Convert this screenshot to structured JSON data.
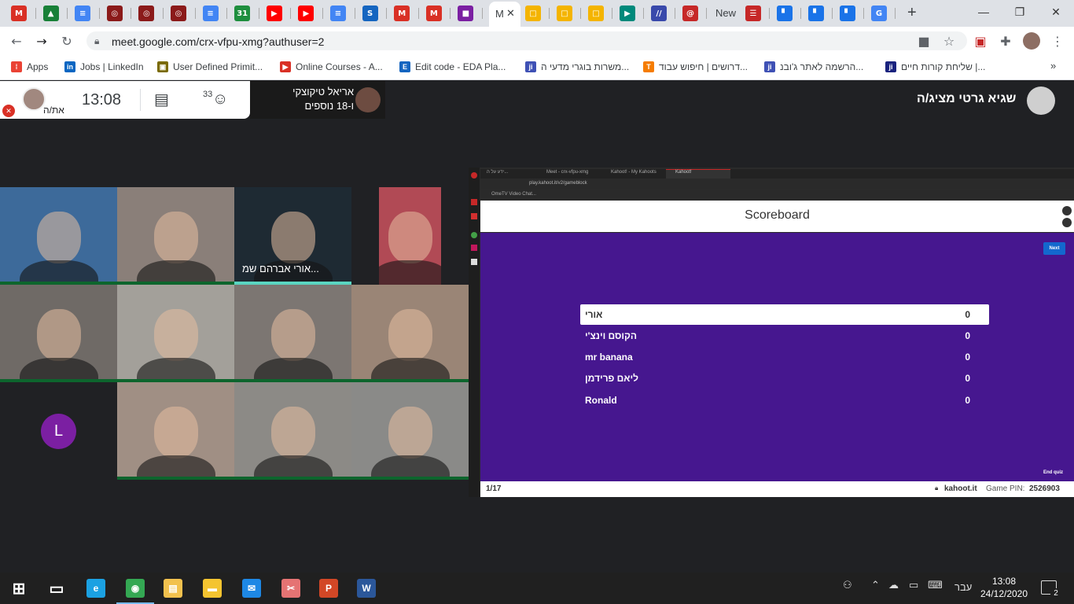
{
  "browser": {
    "tabs": [
      {
        "favicon": "gmail-icon",
        "color": "#d93025",
        "letter": "M"
      },
      {
        "favicon": "drive-icon",
        "color": "#188038",
        "letter": "▲"
      },
      {
        "favicon": "docs-icon",
        "color": "#4285f4",
        "letter": "≡"
      },
      {
        "favicon": "generic-icon",
        "color": "#8b1a1a",
        "letter": "◎"
      },
      {
        "favicon": "generic-icon",
        "color": "#8b1a1a",
        "letter": "◎"
      },
      {
        "favicon": "generic-icon",
        "color": "#8b1a1a",
        "letter": "◎"
      },
      {
        "favicon": "docs-icon",
        "color": "#4285f4",
        "letter": "≡"
      },
      {
        "favicon": "calendar-icon",
        "color": "#1e8e3e",
        "letter": "31"
      },
      {
        "favicon": "youtube-icon",
        "color": "#ff0000",
        "letter": "▶"
      },
      {
        "favicon": "youtube-icon",
        "color": "#ff0000",
        "letter": "▶"
      },
      {
        "favicon": "docs-icon",
        "color": "#4285f4",
        "letter": "≡"
      },
      {
        "favicon": "s-icon",
        "color": "#1565c0",
        "letter": "S"
      },
      {
        "favicon": "gmail-icon",
        "color": "#d93025",
        "letter": "M"
      },
      {
        "favicon": "gmail-icon",
        "color": "#d93025",
        "letter": "M"
      },
      {
        "favicon": "classroom-icon",
        "color": "#7b1fa2",
        "letter": "■"
      }
    ],
    "active_tab_label": "M",
    "tabs_right": [
      {
        "favicon": "slides-icon",
        "color": "#f4b400",
        "letter": "□"
      },
      {
        "favicon": "slides-icon",
        "color": "#f4b400",
        "letter": "□"
      },
      {
        "favicon": "slides-icon",
        "color": "#f4b400",
        "letter": "□"
      },
      {
        "favicon": "meet-icon",
        "color": "#00897b",
        "letter": "▶"
      },
      {
        "favicon": "edu-icon",
        "color": "#3949ab",
        "letter": "//"
      },
      {
        "favicon": "swirl-icon",
        "color": "#c62828",
        "letter": "@"
      }
    ],
    "new_tab_label": "New",
    "tabs_right2": [
      {
        "favicon": "form-icon",
        "color": "#c62828",
        "letter": "☰"
      },
      {
        "favicon": "comment-icon",
        "color": "#1a73e8",
        "letter": "▘"
      },
      {
        "favicon": "comment-icon",
        "color": "#1a73e8",
        "letter": "▘"
      },
      {
        "favicon": "comment-icon",
        "color": "#1a73e8",
        "letter": "▘"
      },
      {
        "favicon": "google-icon",
        "color": "#4285f4",
        "letter": "G"
      }
    ],
    "url": "meet.google.com/crx-vfpu-xmg?authuser=2",
    "bookmarks": [
      {
        "label": "Apps",
        "color": "#ea4335",
        "letter": "⁞"
      },
      {
        "label": "Jobs | LinkedIn",
        "color": "#0a66c2",
        "letter": "in"
      },
      {
        "label": "User Defined Primit...",
        "color": "#7a6a00",
        "letter": "▣"
      },
      {
        "label": "Online Courses - A...",
        "color": "#d93025",
        "letter": "▶"
      },
      {
        "label": "Edit code - EDA Pla...",
        "color": "#1565c0",
        "letter": "E"
      },
      {
        "label": "משרות בוגרי מדעי ה...",
        "color": "#3f51b5",
        "letter": "ji"
      },
      {
        "label": "דרושים | חיפוש עבוד...",
        "color": "#f57c00",
        "letter": "T"
      },
      {
        "label": "הרשמה לאתר ג'ובנ...",
        "color": "#3f51b5",
        "letter": "ji"
      },
      {
        "label": "שליחת קורות חיים |...",
        "color": "#1a237e",
        "letter": "ji"
      }
    ]
  },
  "meet": {
    "self_label": "את/ה",
    "time": "13:08",
    "participants_count": "33",
    "presenter_name": "אריאל טיקוצקי",
    "presenter_others": "ו-18 נוספים",
    "presenting_label": "שגיא גרטי מציג/ה",
    "tile_name": "אורי אברהם שמ...",
    "tile_letter": "L",
    "tiles": [
      {
        "bg": "#3d6a9a"
      },
      {
        "bg": "#8a7f79"
      },
      {
        "bg": "#1e2a33"
      },
      {
        "bg": "#b14a55"
      },
      {
        "bg": "#6f6a66"
      },
      {
        "bg": "#a3a09a"
      },
      {
        "bg": "#7c7672"
      },
      {
        "bg": "#9a8576"
      },
      {
        "bg": "#202124"
      },
      {
        "bg": "#a08f84"
      },
      {
        "bg": "#8c8a86"
      },
      {
        "bg": "#8a8a88"
      }
    ]
  },
  "kahoot": {
    "inner_tabs": [
      "ידע על ה...",
      "Meet - crx-vfpu-xmg",
      "Kahoot! - My Kahoots",
      "Kahoot!"
    ],
    "inner_url": "play.kahoot.it/v2/gameblock",
    "inner_bookmark": "OmeTV Video Chat...",
    "scoreboard_title": "Scoreboard",
    "next_label": "Next",
    "end_quiz_label": "End quiz",
    "rows": [
      {
        "name": "אורי",
        "score": "0"
      },
      {
        "name": "הקוסם וינצ'י",
        "score": "0"
      },
      {
        "name": "mr banana",
        "score": "0"
      },
      {
        "name": "ליאם פרידמן",
        "score": "0"
      },
      {
        "name": "Ronald",
        "score": "0"
      }
    ],
    "progress": "1/17",
    "domain": "kahoot.it",
    "pin_label": "Game PIN:",
    "pin": "2526903"
  },
  "taskbar": {
    "apps": [
      {
        "name": "start-icon",
        "color": "#ffffff",
        "letter": "⊞"
      },
      {
        "name": "task-view-icon",
        "color": "#ffffff",
        "letter": "▭"
      },
      {
        "name": "edge-icon",
        "color": "#1ba1e2",
        "letter": "e"
      },
      {
        "name": "chrome-icon",
        "color": "#34a853",
        "letter": "◉"
      },
      {
        "name": "store-icon",
        "color": "#f2c14e",
        "letter": "▤"
      },
      {
        "name": "file-explorer-icon",
        "color": "#f4c430",
        "letter": "▬"
      },
      {
        "name": "mail-icon",
        "color": "#1e88e5",
        "letter": "✉"
      },
      {
        "name": "snip-icon",
        "color": "#e57373",
        "letter": "✂"
      },
      {
        "name": "powerpoint-icon",
        "color": "#d24726",
        "letter": "P"
      },
      {
        "name": "word-icon",
        "color": "#2b579a",
        "letter": "W"
      }
    ],
    "language": "עבר",
    "clock_time": "13:08",
    "clock_date": "24/12/2020",
    "notifications": "2"
  }
}
